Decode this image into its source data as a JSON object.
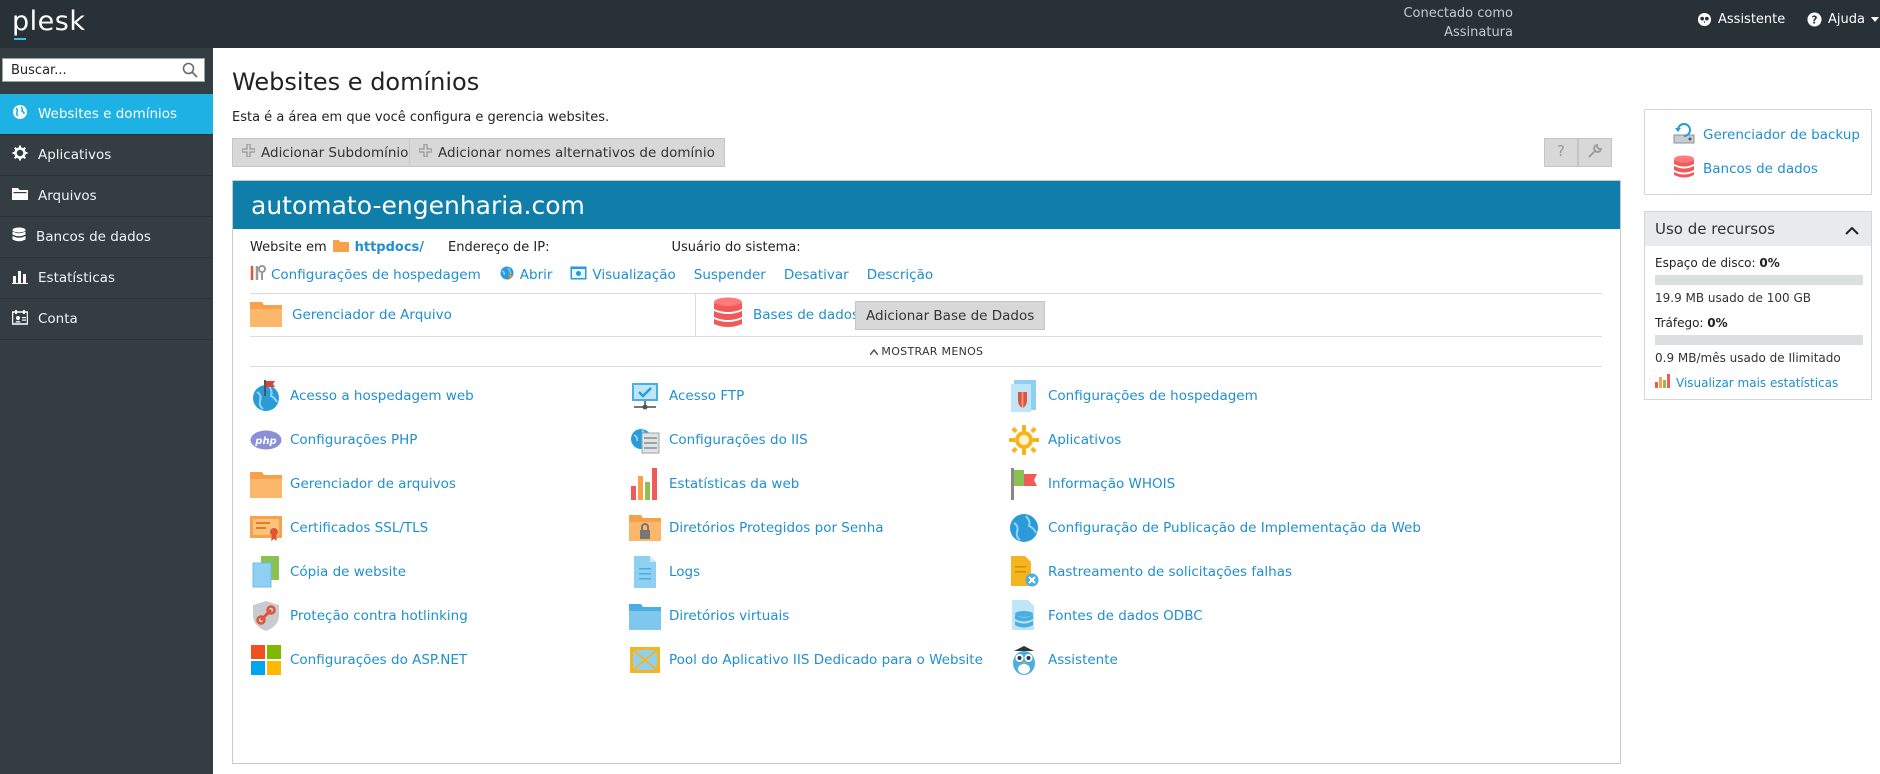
{
  "topbar": {
    "logo": "plesk",
    "connected_line1": "Conectado como",
    "connected_line2": "Assinatura",
    "assistant_label": "Assistente",
    "help_label": "Ajuda"
  },
  "sidebar": {
    "search_placeholder": "Buscar...",
    "items": [
      {
        "label": "Websites e domínios",
        "icon": "globe-icon",
        "active": true
      },
      {
        "label": "Aplicativos",
        "icon": "gear-icon",
        "active": false
      },
      {
        "label": "Arquivos",
        "icon": "folder-icon",
        "active": false
      },
      {
        "label": "Bancos de dados",
        "icon": "database-icon",
        "active": false
      },
      {
        "label": "Estatísticas",
        "icon": "bar-chart-icon",
        "active": false
      },
      {
        "label": "Conta",
        "icon": "account-icon",
        "active": false
      }
    ]
  },
  "main": {
    "title": "Websites e domínios",
    "description": "Esta é a área em que você configura e gerencia websites.",
    "add_subdomain": "Adicionar Subdomínio",
    "add_alias": "Adicionar nomes alternativos de domínio"
  },
  "domain": {
    "name": "automato-engenharia.com",
    "website_in_label": "Website em",
    "docroot": "httpdocs/",
    "ip_label": "Endereço de IP:",
    "sysuser_label": "Usuário do sistema:",
    "actions": {
      "hosting": "Configurações de hospedagem",
      "open": "Abrir",
      "preview": "Visualização",
      "suspend": "Suspender",
      "disable": "Desativar",
      "description": "Descrição"
    },
    "file_manager": "Gerenciador de Arquivo",
    "databases": "Bases de dados",
    "add_database": "Adicionar Base de Dados",
    "show_less": "MOSTRAR MENOS",
    "tools": [
      {
        "label": "Acesso a hospedagem web",
        "icon": "web-hosting-access-icon"
      },
      {
        "label": "Acesso FTP",
        "icon": "ftp-access-icon"
      },
      {
        "label": "Configurações de hospedagem",
        "icon": "hosting-settings-icon"
      },
      {
        "label": "Configurações PHP",
        "icon": "php-icon"
      },
      {
        "label": "Configurações do IIS",
        "icon": "iis-settings-icon"
      },
      {
        "label": "Aplicativos",
        "icon": "applications-icon"
      },
      {
        "label": "Gerenciador de arquivos",
        "icon": "file-manager-icon"
      },
      {
        "label": "Estatísticas da web",
        "icon": "web-statistics-icon"
      },
      {
        "label": "Informação WHOIS",
        "icon": "whois-icon"
      },
      {
        "label": "Certificados SSL/TLS",
        "icon": "ssl-certificate-icon"
      },
      {
        "label": "Diretórios Protegidos por Senha",
        "icon": "protected-directories-icon"
      },
      {
        "label": "Configuração de Publicação de Implementação da Web",
        "icon": "web-deploy-icon"
      },
      {
        "label": "Cópia de website",
        "icon": "website-copy-icon"
      },
      {
        "label": "Logs",
        "icon": "logs-icon"
      },
      {
        "label": "Rastreamento de solicitações falhas",
        "icon": "failed-request-tracing-icon"
      },
      {
        "label": "Proteção contra hotlinking",
        "icon": "hotlink-protection-icon"
      },
      {
        "label": "Diretórios virtuais",
        "icon": "virtual-directories-icon"
      },
      {
        "label": "Fontes de dados ODBC",
        "icon": "odbc-icon"
      },
      {
        "label": "Configurações do ASP.NET",
        "icon": "aspnet-icon"
      },
      {
        "label": "Pool do Aplicativo IIS Dedicado para o Website",
        "icon": "app-pool-icon"
      },
      {
        "label": "Assistente",
        "icon": "assistant-owl-icon"
      }
    ]
  },
  "right": {
    "backup_manager": "Gerenciador de backup",
    "databases": "Bancos de dados",
    "resources_title": "Uso de recursos",
    "disk_label": "Espaço de disco:",
    "disk_percent": "0%",
    "disk_fraction": 0.0,
    "disk_note": "19.9 MB usado de 100 GB",
    "traffic_label": "Tráfego:",
    "traffic_percent": "0%",
    "traffic_fraction": 0.0,
    "traffic_note": "0.9 MB/mês usado de Ilimitado",
    "more_stats": "Visualizar mais estatísticas"
  },
  "colors": {
    "topbar": "#283135",
    "sidebar": "#343d42",
    "active": "#1eb2e4",
    "domain_header": "#0f7fa9",
    "link": "#1f8fcf"
  }
}
